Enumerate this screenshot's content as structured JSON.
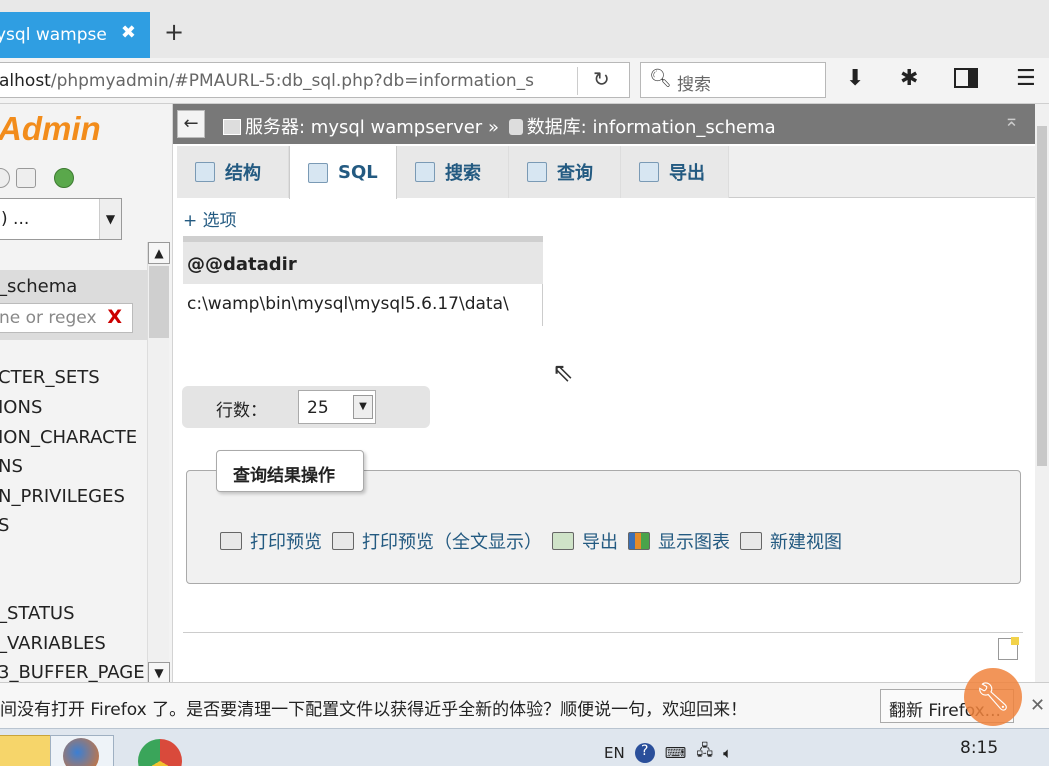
{
  "browser": {
    "tab_title": "ysql wampse",
    "tab_close": "✖",
    "new_tab": "+",
    "url_host": "alhost",
    "url_rest": "/phpmyadmin/#PMAURL-5:db_sql.php?db=information_s",
    "search_placeholder": "搜索",
    "icons": [
      "download-icon",
      "settings-icon",
      "sidebar-icon",
      "menu-icon"
    ]
  },
  "left": {
    "logo": "Admin",
    "db_select": ") ...",
    "db_name": "_schema",
    "filter_placeholder": "ne or regex",
    "filter_clear": "X",
    "tables": [
      "CTER_SETS",
      "IONS",
      "ION_CHARACTE",
      "NS",
      "N_PRIVILEGES",
      "S",
      "",
      "",
      "_STATUS",
      "_VARIABLES",
      "3_BUFFER_PAGE"
    ]
  },
  "header": {
    "back": "←",
    "server": "服务器: mysql wampserver",
    "sep": "»",
    "database": "数据库: information_schema"
  },
  "tabs": [
    {
      "label": "结构",
      "icon": "structure-icon"
    },
    {
      "label": "SQL",
      "icon": "sql-icon",
      "active": true
    },
    {
      "label": "搜索",
      "icon": "search-icon"
    },
    {
      "label": "查询",
      "icon": "query-icon"
    },
    {
      "label": "导出",
      "icon": "export-icon"
    }
  ],
  "options_link": "+ 选项",
  "result": {
    "column": "@@datadir",
    "value": "c:\\wamp\\bin\\mysql\\mysql5.6.17\\data\\"
  },
  "rows": {
    "label": "行数：",
    "value": "25"
  },
  "query_ops": {
    "legend": "查询结果操作",
    "actions": [
      {
        "label": "打印预览",
        "icon": "print-icon"
      },
      {
        "label": "打印预览（全文显示）",
        "icon": "print-icon"
      },
      {
        "label": "导出",
        "icon": "export-icon"
      },
      {
        "label": "显示图表",
        "icon": "chart-icon"
      },
      {
        "label": "新建视图",
        "icon": "view-icon"
      }
    ]
  },
  "notification": {
    "message": "间没有打开 Firefox 了。是否要清理一下配置文件以获得近乎全新的体验？顺便说一句，欢迎回来！",
    "button": "翻新 Firefox...",
    "close": "✕"
  },
  "taskbar": {
    "lang": "EN",
    "time": "8:15"
  }
}
